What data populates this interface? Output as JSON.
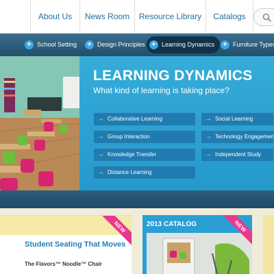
{
  "top_nav": {
    "links": [
      "About Us",
      "News Room",
      "Resource Library",
      "Catalogs"
    ]
  },
  "sub_nav": {
    "items": [
      "School Setting",
      "Design Principles",
      "Learning Dynamics",
      "Furniture Types"
    ],
    "active": "Learning Dynamics"
  },
  "hero": {
    "title": "LEARNING DYNAMICS",
    "subtitle": "What kind of learning is taking place?",
    "options_left": [
      "Collaborative Learning",
      "Group Interaction",
      "Knowledge Transfer",
      "Distance Learning"
    ],
    "options_right": [
      "Social Learning",
      "Technology Engagement",
      "Independent Study"
    ]
  },
  "cards": {
    "seating": {
      "title": "Student Seating That Moves",
      "item": "The Flavors™ Noodle™ Chair",
      "badge": "NEW"
    },
    "catalog": {
      "title": "2013 CATALOG",
      "badge": "NEW"
    }
  },
  "colors": {
    "accent_blue": "#2ea3d5",
    "nav_dark": "#214f6b",
    "link_blue": "#1f6f9e",
    "badge_pink": "#e8388d",
    "arrow_green": "#c8e89a"
  },
  "icons": [
    "search-icon",
    "plus-icon",
    "arrow-right-icon"
  ]
}
